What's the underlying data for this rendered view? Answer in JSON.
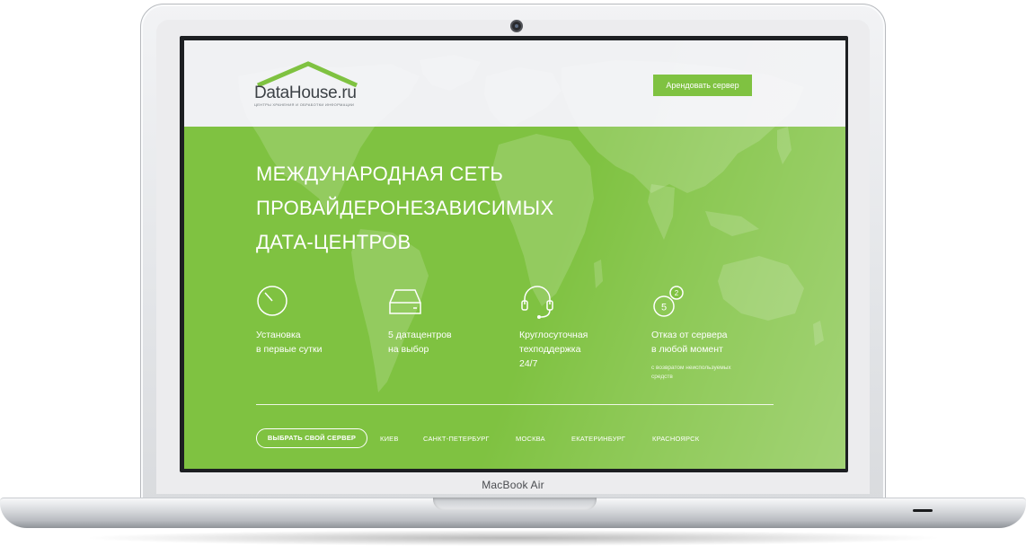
{
  "device": {
    "model_label": "MacBook Air"
  },
  "colors": {
    "brand_green": "#7fc241",
    "header_bg": "#f0f1f3",
    "text_white": "#ffffff",
    "logo_text": "#3d4247"
  },
  "header": {
    "logo_text": "DataHouse.ru",
    "logo_tagline": "ЦЕНТРЫ ХРАНЕНИЯ И ОБРАБОТКИ ИНФОРМАЦИИ",
    "rent_button_label": "Арендовать сервер"
  },
  "hero": {
    "title_lines": [
      "МЕЖДУНАРОДНАЯ СЕТЬ",
      "ПРОВАЙДЕРОНЕЗАВИСИМЫХ",
      "ДАТА-ЦЕНТРОВ"
    ]
  },
  "features": [
    {
      "icon": "clock-icon",
      "lines": [
        "Установка",
        "в первые сутки"
      ]
    },
    {
      "icon": "server-drive-icon",
      "lines": [
        "5 датацентров",
        "на выбор"
      ]
    },
    {
      "icon": "headset-icon",
      "lines": [
        "Круглосуточная",
        "техподдержка",
        "24/7"
      ]
    },
    {
      "icon": "refund-badge-icon",
      "badge_main": "5",
      "badge_small": "2",
      "lines": [
        "Отказ от сервера",
        "в любой момент"
      ],
      "note_lines": [
        "с возвратом неиспользуемых",
        "средств"
      ]
    }
  ],
  "bottom_nav": {
    "choose_button_label": "ВЫБРАТЬ СВОЙ СЕРВЕР",
    "cities": [
      "КИЕВ",
      "САНКТ-ПЕТЕРБУРГ",
      "МОСКВА",
      "ЕКАТЕРИНБУРГ",
      "КРАСНОЯРСК"
    ]
  }
}
